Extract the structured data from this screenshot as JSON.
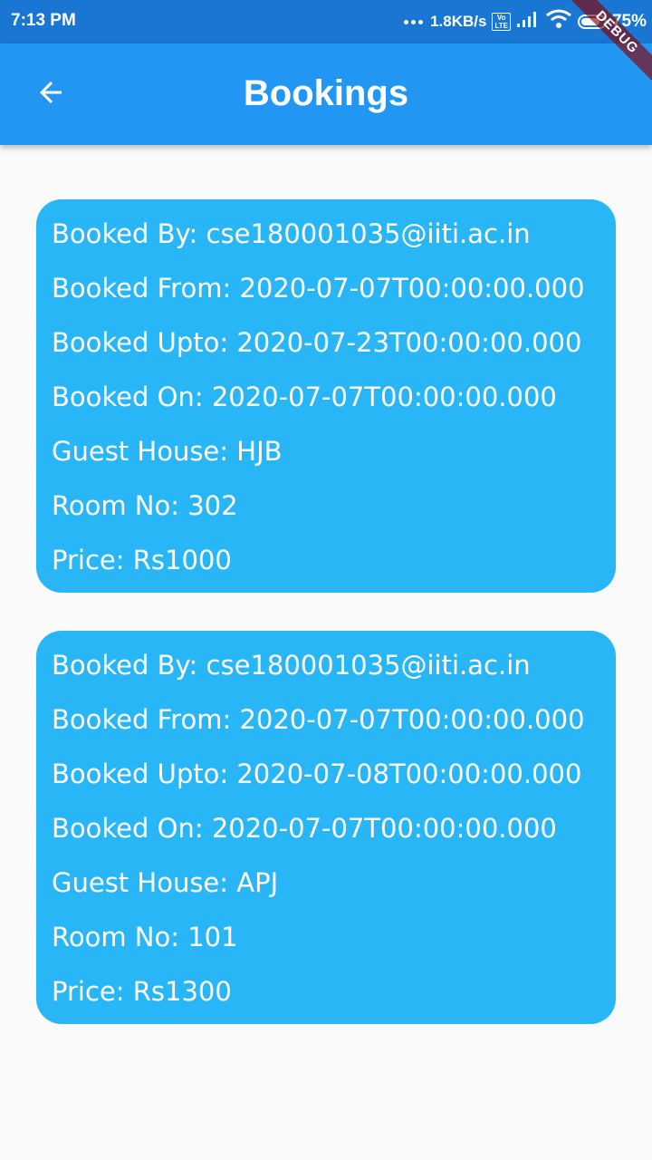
{
  "status_bar": {
    "time": "7:13 PM",
    "net_speed": "1.8KB/s",
    "volte_label": "Vo\nLTE",
    "battery": "75%"
  },
  "app_bar": {
    "back_icon": "arrow-back-icon",
    "title": "Bookings",
    "debug_label": "DEBUG"
  },
  "colors": {
    "status_bar": "#1976d2",
    "app_bar": "#2196f3",
    "card": "#29b6f6",
    "background": "#fafafa"
  },
  "bookings": [
    {
      "booked_by_label": "Booked By: ",
      "booked_by": "cse180001035@iiti.ac.in",
      "booked_from_label": "Booked From: ",
      "booked_from": "2020-07-07T00:00:00.000",
      "booked_upto_label": "Booked Upto: ",
      "booked_upto": "2020-07-23T00:00:00.000",
      "booked_on_label": "Booked On: ",
      "booked_on": "2020-07-07T00:00:00.000",
      "guest_house_label": "Guest House: ",
      "guest_house": "HJB",
      "room_no_label": "Room No: ",
      "room_no": "302",
      "price_label": "Price: ",
      "price": "Rs1000"
    },
    {
      "booked_by_label": "Booked By: ",
      "booked_by": "cse180001035@iiti.ac.in",
      "booked_from_label": "Booked From: ",
      "booked_from": "2020-07-07T00:00:00.000",
      "booked_upto_label": "Booked Upto: ",
      "booked_upto": "2020-07-08T00:00:00.000",
      "booked_on_label": "Booked On: ",
      "booked_on": "2020-07-07T00:00:00.000",
      "guest_house_label": "Guest House: ",
      "guest_house": "APJ",
      "room_no_label": "Room No: ",
      "room_no": "101",
      "price_label": "Price: ",
      "price": "Rs1300"
    }
  ]
}
